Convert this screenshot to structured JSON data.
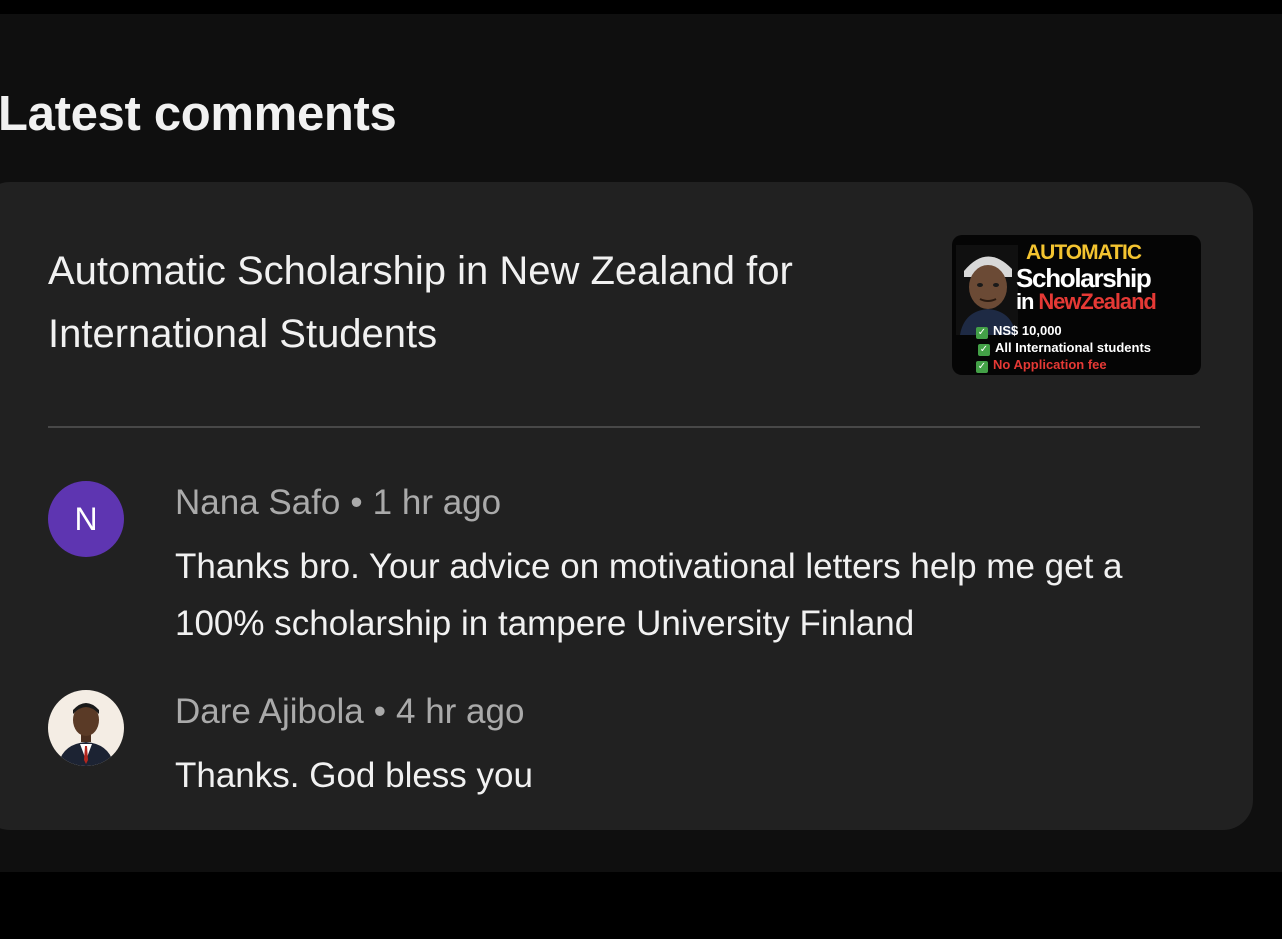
{
  "section": {
    "title": "Latest comments"
  },
  "video": {
    "title": "Automatic Scholarship in New Zealand for International Students",
    "thumbnail": {
      "line1": "AUTOMATIC",
      "line2": "Scholarship",
      "line3_prefix": "in ",
      "line3_highlight": "NewZealand",
      "bullets": [
        "NS$ 10,000",
        "All International students",
        "No Application fee"
      ],
      "colors": {
        "accent_yellow": "#f4c430",
        "accent_red": "#e53935",
        "check_green": "#43a047"
      }
    }
  },
  "comments": [
    {
      "author": "Nana Safo",
      "separator": "•",
      "time": "1 hr ago",
      "text": "Thanks bro. Your advice on motivational letters help me get a 100% scholarship in tampere University Finland",
      "avatar": {
        "type": "letter",
        "letter": "N",
        "color": "#5e35b1"
      }
    },
    {
      "author": "Dare Ajibola",
      "separator": "•",
      "time": "4 hr ago",
      "text": "Thanks. God bless you",
      "avatar": {
        "type": "photo",
        "icon": "person-photo-icon"
      }
    }
  ],
  "theme": {
    "page_bg": "#0f0f0f",
    "card_bg": "#212121",
    "primary_text": "#f1f1f1",
    "secondary_text": "#aaaaaa"
  }
}
